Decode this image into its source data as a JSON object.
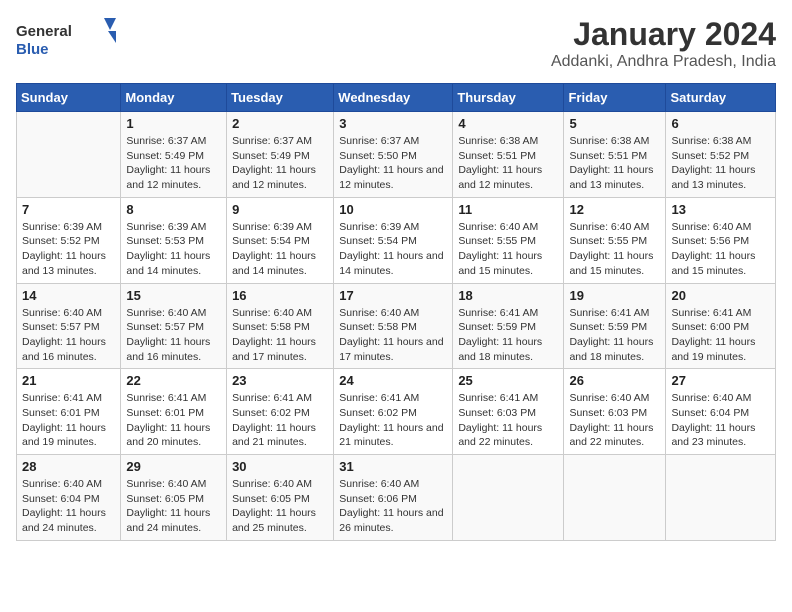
{
  "logo": {
    "general": "General",
    "blue": "Blue"
  },
  "title": "January 2024",
  "subtitle": "Addanki, Andhra Pradesh, India",
  "days_header": [
    "Sunday",
    "Monday",
    "Tuesday",
    "Wednesday",
    "Thursday",
    "Friday",
    "Saturday"
  ],
  "weeks": [
    [
      {
        "num": "",
        "sunrise": "",
        "sunset": "",
        "daylight": ""
      },
      {
        "num": "1",
        "sunrise": "Sunrise: 6:37 AM",
        "sunset": "Sunset: 5:49 PM",
        "daylight": "Daylight: 11 hours and 12 minutes."
      },
      {
        "num": "2",
        "sunrise": "Sunrise: 6:37 AM",
        "sunset": "Sunset: 5:49 PM",
        "daylight": "Daylight: 11 hours and 12 minutes."
      },
      {
        "num": "3",
        "sunrise": "Sunrise: 6:37 AM",
        "sunset": "Sunset: 5:50 PM",
        "daylight": "Daylight: 11 hours and 12 minutes."
      },
      {
        "num": "4",
        "sunrise": "Sunrise: 6:38 AM",
        "sunset": "Sunset: 5:51 PM",
        "daylight": "Daylight: 11 hours and 12 minutes."
      },
      {
        "num": "5",
        "sunrise": "Sunrise: 6:38 AM",
        "sunset": "Sunset: 5:51 PM",
        "daylight": "Daylight: 11 hours and 13 minutes."
      },
      {
        "num": "6",
        "sunrise": "Sunrise: 6:38 AM",
        "sunset": "Sunset: 5:52 PM",
        "daylight": "Daylight: 11 hours and 13 minutes."
      }
    ],
    [
      {
        "num": "7",
        "sunrise": "Sunrise: 6:39 AM",
        "sunset": "Sunset: 5:52 PM",
        "daylight": "Daylight: 11 hours and 13 minutes."
      },
      {
        "num": "8",
        "sunrise": "Sunrise: 6:39 AM",
        "sunset": "Sunset: 5:53 PM",
        "daylight": "Daylight: 11 hours and 14 minutes."
      },
      {
        "num": "9",
        "sunrise": "Sunrise: 6:39 AM",
        "sunset": "Sunset: 5:54 PM",
        "daylight": "Daylight: 11 hours and 14 minutes."
      },
      {
        "num": "10",
        "sunrise": "Sunrise: 6:39 AM",
        "sunset": "Sunset: 5:54 PM",
        "daylight": "Daylight: 11 hours and 14 minutes."
      },
      {
        "num": "11",
        "sunrise": "Sunrise: 6:40 AM",
        "sunset": "Sunset: 5:55 PM",
        "daylight": "Daylight: 11 hours and 15 minutes."
      },
      {
        "num": "12",
        "sunrise": "Sunrise: 6:40 AM",
        "sunset": "Sunset: 5:55 PM",
        "daylight": "Daylight: 11 hours and 15 minutes."
      },
      {
        "num": "13",
        "sunrise": "Sunrise: 6:40 AM",
        "sunset": "Sunset: 5:56 PM",
        "daylight": "Daylight: 11 hours and 15 minutes."
      }
    ],
    [
      {
        "num": "14",
        "sunrise": "Sunrise: 6:40 AM",
        "sunset": "Sunset: 5:57 PM",
        "daylight": "Daylight: 11 hours and 16 minutes."
      },
      {
        "num": "15",
        "sunrise": "Sunrise: 6:40 AM",
        "sunset": "Sunset: 5:57 PM",
        "daylight": "Daylight: 11 hours and 16 minutes."
      },
      {
        "num": "16",
        "sunrise": "Sunrise: 6:40 AM",
        "sunset": "Sunset: 5:58 PM",
        "daylight": "Daylight: 11 hours and 17 minutes."
      },
      {
        "num": "17",
        "sunrise": "Sunrise: 6:40 AM",
        "sunset": "Sunset: 5:58 PM",
        "daylight": "Daylight: 11 hours and 17 minutes."
      },
      {
        "num": "18",
        "sunrise": "Sunrise: 6:41 AM",
        "sunset": "Sunset: 5:59 PM",
        "daylight": "Daylight: 11 hours and 18 minutes."
      },
      {
        "num": "19",
        "sunrise": "Sunrise: 6:41 AM",
        "sunset": "Sunset: 5:59 PM",
        "daylight": "Daylight: 11 hours and 18 minutes."
      },
      {
        "num": "20",
        "sunrise": "Sunrise: 6:41 AM",
        "sunset": "Sunset: 6:00 PM",
        "daylight": "Daylight: 11 hours and 19 minutes."
      }
    ],
    [
      {
        "num": "21",
        "sunrise": "Sunrise: 6:41 AM",
        "sunset": "Sunset: 6:01 PM",
        "daylight": "Daylight: 11 hours and 19 minutes."
      },
      {
        "num": "22",
        "sunrise": "Sunrise: 6:41 AM",
        "sunset": "Sunset: 6:01 PM",
        "daylight": "Daylight: 11 hours and 20 minutes."
      },
      {
        "num": "23",
        "sunrise": "Sunrise: 6:41 AM",
        "sunset": "Sunset: 6:02 PM",
        "daylight": "Daylight: 11 hours and 21 minutes."
      },
      {
        "num": "24",
        "sunrise": "Sunrise: 6:41 AM",
        "sunset": "Sunset: 6:02 PM",
        "daylight": "Daylight: 11 hours and 21 minutes."
      },
      {
        "num": "25",
        "sunrise": "Sunrise: 6:41 AM",
        "sunset": "Sunset: 6:03 PM",
        "daylight": "Daylight: 11 hours and 22 minutes."
      },
      {
        "num": "26",
        "sunrise": "Sunrise: 6:40 AM",
        "sunset": "Sunset: 6:03 PM",
        "daylight": "Daylight: 11 hours and 22 minutes."
      },
      {
        "num": "27",
        "sunrise": "Sunrise: 6:40 AM",
        "sunset": "Sunset: 6:04 PM",
        "daylight": "Daylight: 11 hours and 23 minutes."
      }
    ],
    [
      {
        "num": "28",
        "sunrise": "Sunrise: 6:40 AM",
        "sunset": "Sunset: 6:04 PM",
        "daylight": "Daylight: 11 hours and 24 minutes."
      },
      {
        "num": "29",
        "sunrise": "Sunrise: 6:40 AM",
        "sunset": "Sunset: 6:05 PM",
        "daylight": "Daylight: 11 hours and 24 minutes."
      },
      {
        "num": "30",
        "sunrise": "Sunrise: 6:40 AM",
        "sunset": "Sunset: 6:05 PM",
        "daylight": "Daylight: 11 hours and 25 minutes."
      },
      {
        "num": "31",
        "sunrise": "Sunrise: 6:40 AM",
        "sunset": "Sunset: 6:06 PM",
        "daylight": "Daylight: 11 hours and 26 minutes."
      },
      {
        "num": "",
        "sunrise": "",
        "sunset": "",
        "daylight": ""
      },
      {
        "num": "",
        "sunrise": "",
        "sunset": "",
        "daylight": ""
      },
      {
        "num": "",
        "sunrise": "",
        "sunset": "",
        "daylight": ""
      }
    ]
  ]
}
